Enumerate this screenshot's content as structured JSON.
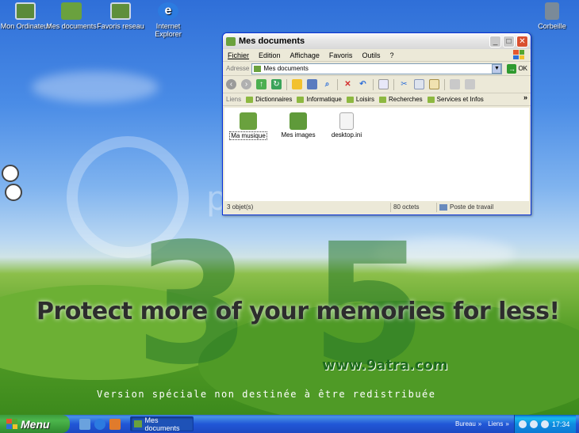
{
  "desktop": {
    "icons": [
      {
        "label": "Mon Ordinateur"
      },
      {
        "label": "Mes documents"
      },
      {
        "label": "Favoris reseau"
      },
      {
        "label": "Internet Explorer"
      },
      {
        "label": "Corbeille"
      }
    ],
    "watermark": "photobucket",
    "big_numbers": [
      "3",
      "5"
    ],
    "slogan": "Protect more of your memories for less!",
    "site": "www.9atra.com",
    "version_text": "Version spéciale non destinée à être redistribuée"
  },
  "window": {
    "title": "Mes documents",
    "controls": {
      "minimize": "_",
      "maximize": "□",
      "close": "✕"
    },
    "menu": [
      "Fichier",
      "Edition",
      "Affichage",
      "Favoris",
      "Outils",
      "?"
    ],
    "address": {
      "label": "Adresse",
      "value": "Mes documents",
      "go": "OK"
    },
    "links": {
      "label": "Liens",
      "items": [
        "Dictionnaires",
        "Informatique",
        "Loisirs",
        "Recherches",
        "Services et Infos"
      ]
    },
    "files": [
      {
        "name": "Ma musique",
        "selected": true
      },
      {
        "name": "Mes images",
        "selected": false
      },
      {
        "name": "desktop.ini",
        "selected": false
      }
    ],
    "status": {
      "objects": "3 objet(s)",
      "size": "80 octets",
      "location": "Poste de travail"
    }
  },
  "taskbar": {
    "start_label": "Menu",
    "task_label": "Mes documents",
    "toolbar_bureau": "Bureau",
    "toolbar_liens": "Liens",
    "more": "»",
    "clock": "17:34"
  },
  "colors": {
    "taskbar": "#2157d7",
    "start_button": "#3c9a3c",
    "window_border": "#0831d9",
    "window_face": "#ece9d8"
  }
}
